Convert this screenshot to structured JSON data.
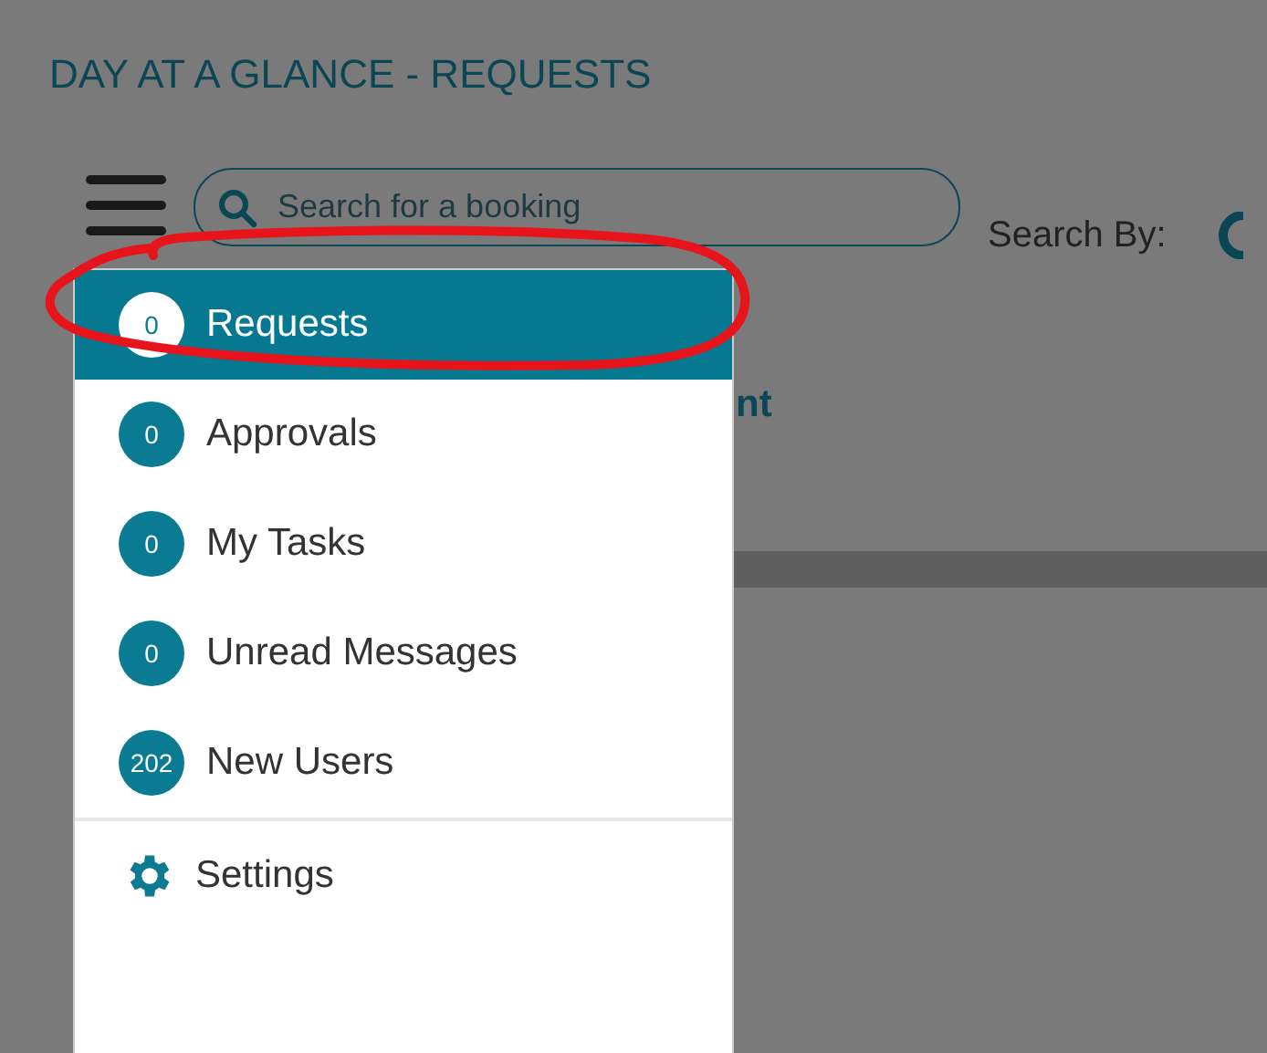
{
  "page_title": "DAY AT A GLANCE - REQUESTS",
  "search": {
    "placeholder": "Search for a booking"
  },
  "search_by": "Search By:",
  "underlying_text": "nt",
  "menu": {
    "items": [
      {
        "count": "0",
        "label": "Requests",
        "selected": true
      },
      {
        "count": "0",
        "label": "Approvals",
        "selected": false
      },
      {
        "count": "0",
        "label": "My Tasks",
        "selected": false
      },
      {
        "count": "0",
        "label": "Unread Messages",
        "selected": false
      },
      {
        "count": "202",
        "label": "New Users",
        "selected": false
      }
    ],
    "settings": "Settings"
  }
}
